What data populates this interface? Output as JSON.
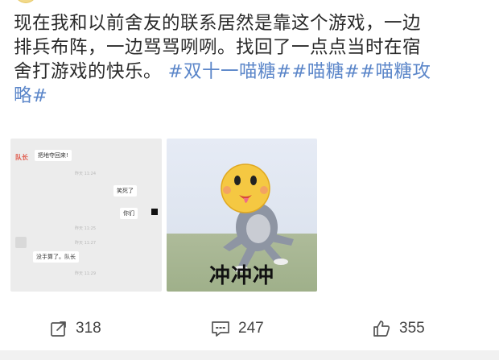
{
  "post": {
    "text_lines": [
      "现在我和以前舍友的联系居然是靠这个游戏，一边",
      "排兵布阵，一边骂骂咧咧。找回了一点点当时在宿",
      "舍打游戏的快乐。"
    ],
    "tags_line3": "#双十一喵糖##喵糖##喵糖攻",
    "tags_line4": "略#"
  },
  "chat_image": {
    "captain_label": "队长",
    "messages": [
      {
        "text": "把地夺回来!"
      },
      {
        "text": "笑死了"
      },
      {
        "text": "你们"
      },
      {
        "text": "没手算了。队长"
      }
    ],
    "timestamps": [
      "昨天 11:24",
      "昨天 11:25",
      "昨天 11:27",
      "昨天 11:29"
    ]
  },
  "meme_image": {
    "caption": "冲冲冲",
    "face_color": "#f5c842"
  },
  "actions": {
    "share_count": "318",
    "comment_count": "247",
    "like_count": "355"
  },
  "colors": {
    "tag": "#5b86c9",
    "text": "#2a2a2a"
  }
}
